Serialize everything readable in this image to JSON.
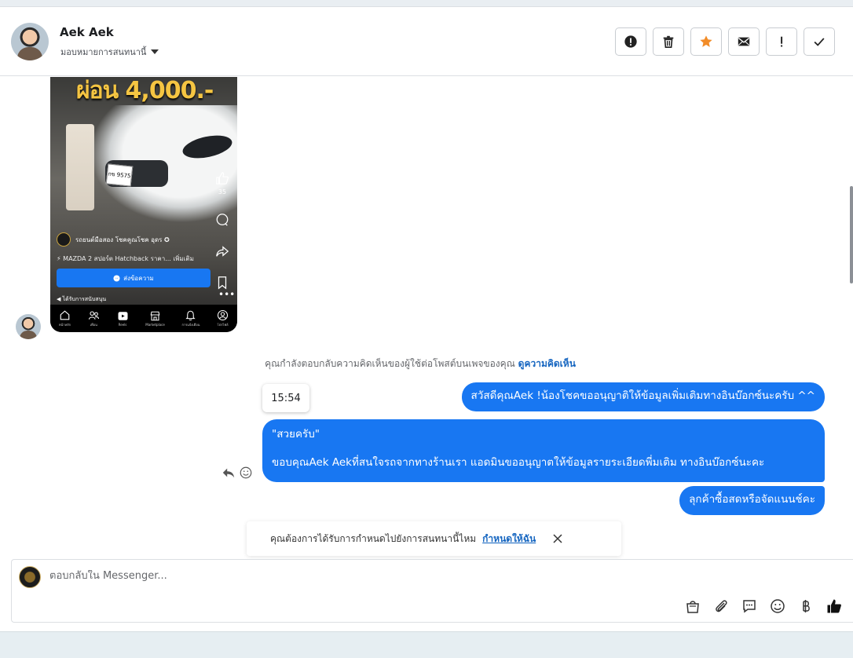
{
  "header": {
    "contact_name": "Aek Aek",
    "assign_label": "มอบหมายการสนทนานี้",
    "actions": [
      {
        "name": "report-spam",
        "icon": "exclamation-circle-icon"
      },
      {
        "name": "delete",
        "icon": "trash-icon"
      },
      {
        "name": "star",
        "icon": "star-icon",
        "color": "#f28c28"
      },
      {
        "name": "mark-unread",
        "icon": "envelope-icon"
      },
      {
        "name": "follow-up",
        "icon": "exclamation-icon"
      },
      {
        "name": "mark-done",
        "icon": "check-icon"
      }
    ]
  },
  "post": {
    "price_text": "ผ่อน 4,000.-",
    "plate_text": "กข 9575",
    "like_count": "35",
    "page_name": "รถยนต์มือสอง โชคคูณโชค อุดร ✪",
    "description": "⚡ MAZDA 2 สปอร์ต Hatchback ราคา... เพิ่มเติม",
    "send_button": "ส่งข้อความ",
    "sponsored": "ได้รับการสนับสนุน",
    "tabs": [
      "หน้าหลัก",
      "เพื่อน",
      "Reels",
      "Marketplace",
      "การแจ้งเตือน",
      "โปรไฟล์"
    ]
  },
  "context": {
    "text": "คุณกำลังตอบกลับความคิดเห็นของผู้ใช้ต่อโพสต์บนเพจของคุณ",
    "link": "ดูความคิดเห็น"
  },
  "time_tip": "15:54",
  "messages": {
    "m1": "สวัสดีคุณAek !น้องโชคขออนุญาติให้ข้อมูลเพิ่มเติมทางอินบ๊อกซ์นะครับ ^^",
    "m2_line1": "\"สวยครับ\"",
    "m2_line2": "ขอบคุณAek Aekที่สนใจรถจากทางร้านเรา แอดมินขออนุญาตให้ข้อมูลรายระเอียดพี่มเติม ทางอินบ๊อกซ์นะคะ",
    "m3": "ลุกค้าซื้อสดหรือจัดแนนช์คะ"
  },
  "assign_prompt": {
    "text": "คุณต้องการได้รับการกำหนดไปยังการสนทนานี้ไหม",
    "link": "กำหนดให้ฉัน"
  },
  "composer": {
    "placeholder": "ตอบกลับใน Messenger...",
    "tools": [
      "shopping-bag-icon",
      "paperclip-icon",
      "saved-reply-icon",
      "emoji-icon",
      "baht-icon",
      "thumbs-up-icon"
    ]
  },
  "colors": {
    "bubble": "#1877f2",
    "link": "#1565c0",
    "star": "#f28c28"
  }
}
